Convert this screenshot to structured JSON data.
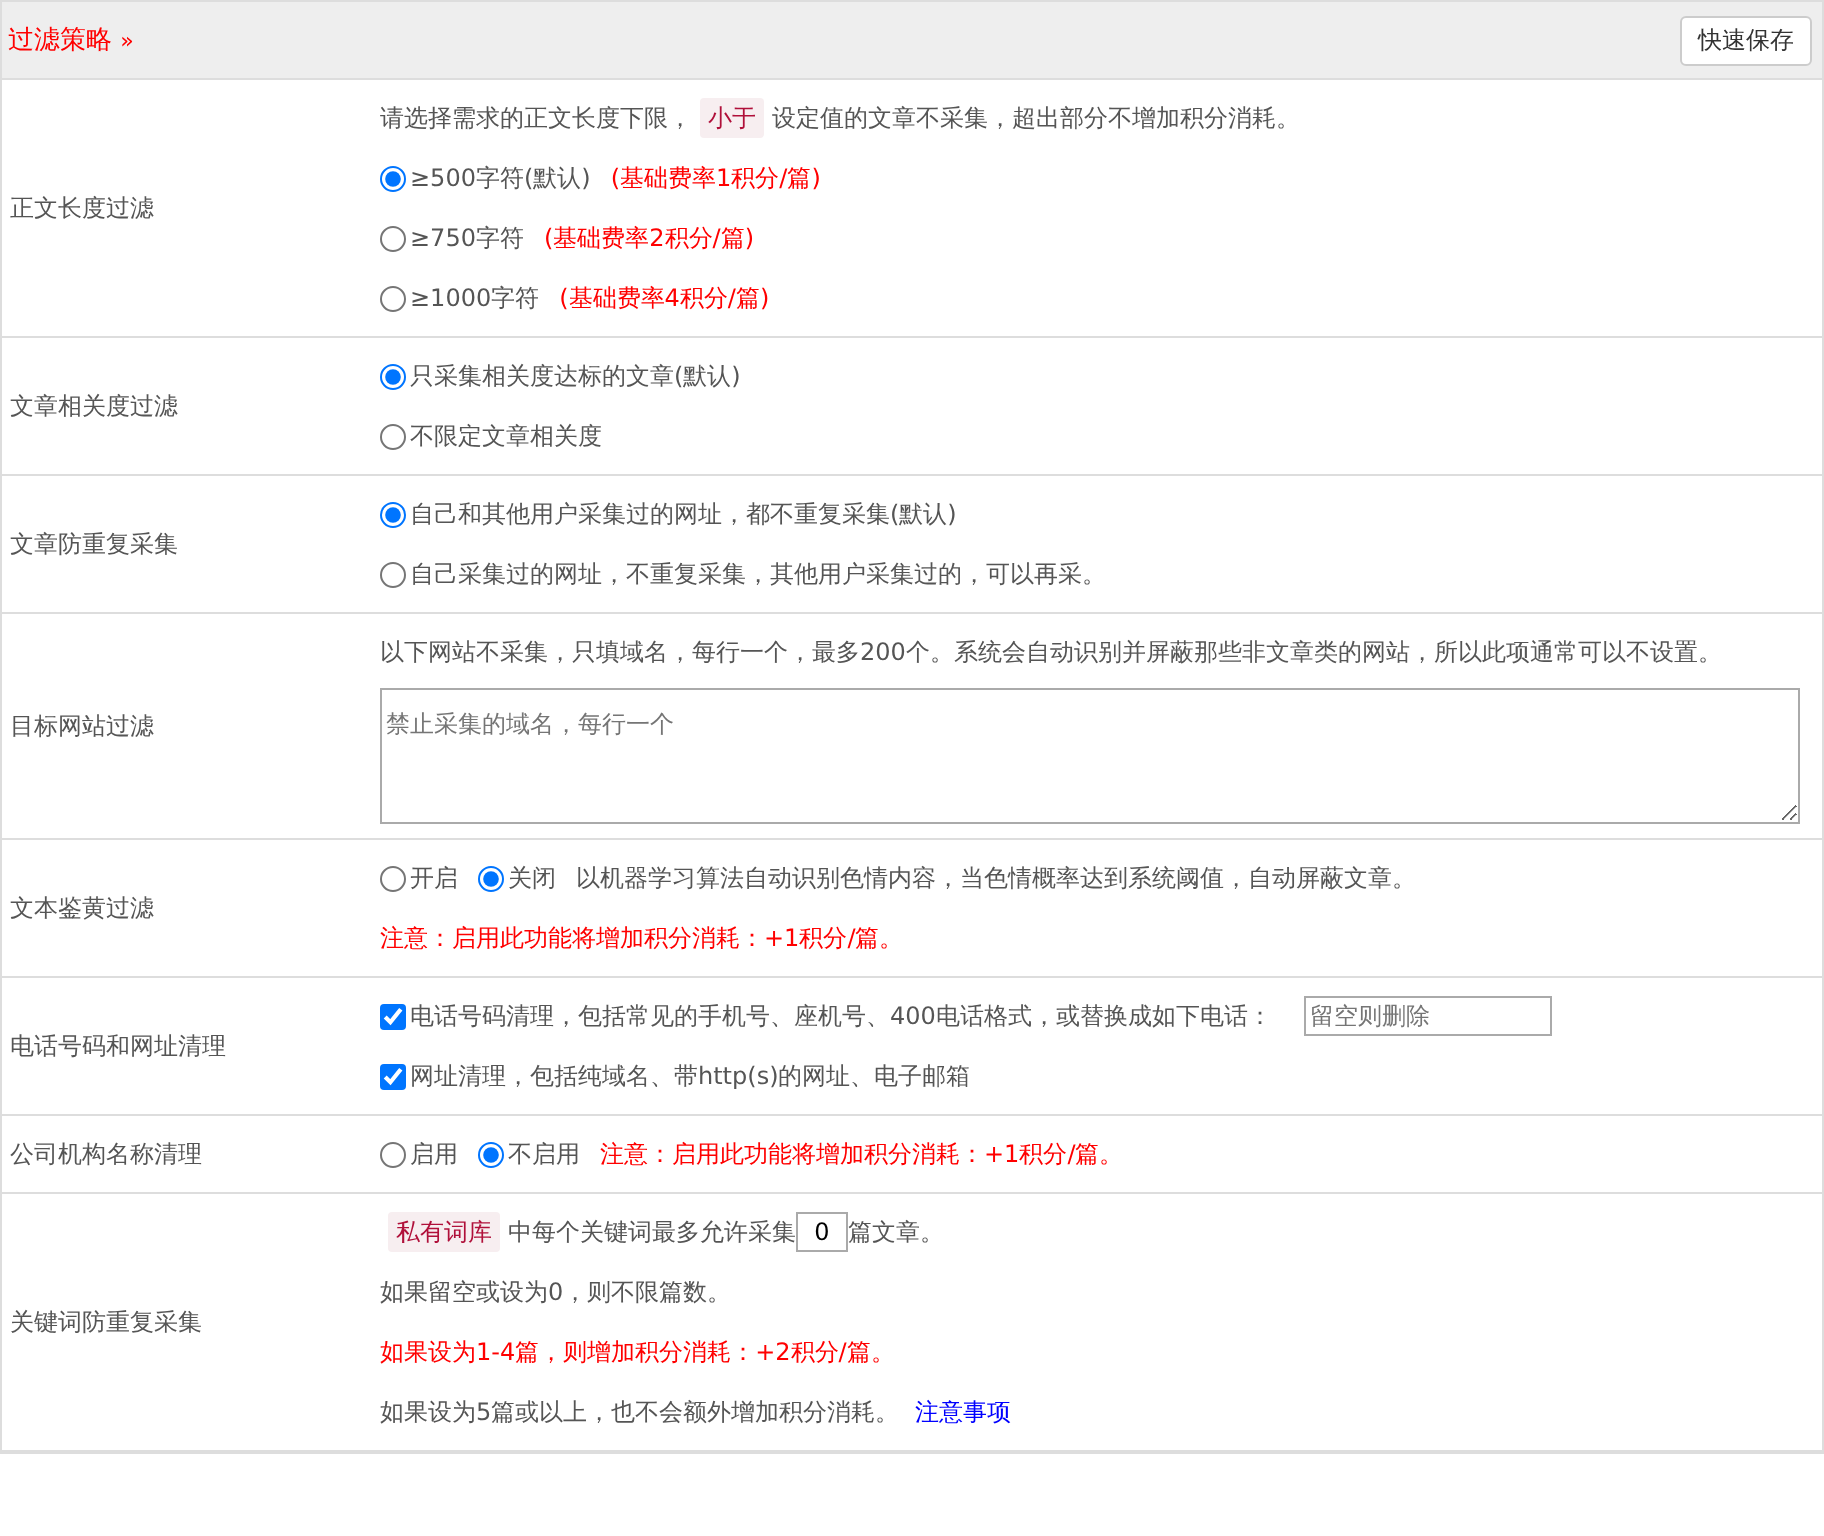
{
  "header": {
    "title": "过滤策略",
    "toggle": "»",
    "save_button": "快速保存"
  },
  "rows": [
    {
      "label": "正文长度过滤",
      "items": [
        {
          "kind": "note",
          "parts": [
            {
              "text": "请选择需求的正文长度下限，"
            },
            {
              "text": "小于",
              "tag": true
            },
            {
              "text": "设定值的文章不采集，超出部分不增加积分消耗。"
            }
          ]
        },
        {
          "kind": "radio",
          "label": "≥500字符(默认)",
          "extra": "(基础费率1积分/篇)",
          "selected": true
        },
        {
          "kind": "radio",
          "label": "≥750字符",
          "extra": "(基础费率2积分/篇)",
          "selected": false
        },
        {
          "kind": "radio",
          "label": "≥1000字符",
          "extra": "(基础费率4积分/篇)",
          "selected": false
        }
      ]
    },
    {
      "label": "文章相关度过滤",
      "items": [
        {
          "kind": "radio",
          "label": "只采集相关度达标的文章(默认)",
          "selected": true
        },
        {
          "kind": "radio",
          "label": "不限定文章相关度",
          "selected": false
        }
      ]
    },
    {
      "label": "文章防重复采集",
      "items": [
        {
          "kind": "radio",
          "label": "自己和其他用户采集过的网址，都不重复采集(默认)",
          "selected": true
        },
        {
          "kind": "radio",
          "label": "自己采集过的网址，不重复采集，其他用户采集过的，可以再采。",
          "selected": false
        }
      ]
    },
    {
      "label": "目标网站过滤",
      "items": [
        {
          "kind": "note",
          "parts": [
            {
              "text": "以下网站不采集，只填域名，每行一个，最多200个。系统会自动识别并屏蔽那些非文章类的网站，所以此项通常可以不设置。"
            }
          ]
        },
        {
          "kind": "textarea",
          "placeholder": "禁止采集的域名，每行一个"
        }
      ]
    },
    {
      "label": "文本鉴黄过滤",
      "items": [
        {
          "kind": "radiogroup",
          "options": [
            {
              "label": "开启",
              "selected": false
            },
            {
              "label": "关闭",
              "selected": true
            }
          ],
          "text": "以机器学习算法自动识别色情内容，当色情概率达到系统阈值，自动屏蔽文章。"
        },
        {
          "kind": "warning",
          "text": "注意：启用此功能将增加积分消耗：+1积分/篇。"
        }
      ]
    },
    {
      "label": "电话号码和网址清理",
      "items": [
        {
          "kind": "checkbox",
          "label": "电话号码清理，包括常见的手机号、座机号、400电话格式，或替换成如下电话：",
          "checked": true,
          "placeholder": "留空则删除"
        },
        {
          "kind": "checkbox",
          "label": "网址清理，包括纯域名、带http(s)的网址、电子邮箱",
          "checked": true
        }
      ]
    },
    {
      "label": "公司机构名称清理",
      "items": [
        {
          "kind": "radiogroup",
          "options": [
            {
              "label": "启用",
              "selected": false
            },
            {
              "label": "不启用",
              "selected": true
            }
          ],
          "warning": "注意：启用此功能将增加积分消耗：+1积分/篇。"
        }
      ]
    },
    {
      "label": "关键词防重复采集",
      "items": [
        {
          "kind": "note",
          "parts": [
            {
              "text": "私有词库",
              "tag": true
            },
            {
              "text": "中每个关键词最多允许采集"
            },
            {
              "input": "0"
            },
            {
              "text": "篇文章。"
            }
          ]
        },
        {
          "kind": "note",
          "parts": [
            {
              "text": "如果留空或设为0，则不限篇数。"
            }
          ]
        },
        {
          "kind": "warning",
          "text": "如果设为1-4篇，则增加积分消耗：+2积分/篇。"
        },
        {
          "kind": "note",
          "parts": [
            {
              "text": "如果设为5篇或以上，也不会额外增加积分消耗。"
            },
            {
              "link": "注意事项"
            }
          ]
        }
      ]
    }
  ]
}
